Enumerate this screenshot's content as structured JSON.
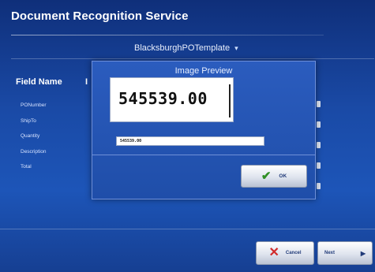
{
  "app": {
    "title": "Document Recognition Service"
  },
  "template": {
    "selected": "BlacksburghPOTemplate",
    "chevron_icon": "chevron-down-icon"
  },
  "fields": {
    "header": "Field Name",
    "header_partial": "I",
    "items": [
      "PONumber",
      "ShipTo",
      "Quantity",
      "Description",
      "Total"
    ]
  },
  "dialog": {
    "title": "Image Preview",
    "preview_value": "545539.00",
    "input_value": "545539.00",
    "ok_label": "OK",
    "ok_icon": "checkmark-icon"
  },
  "buttons": {
    "cancel_label": "Cancel",
    "cancel_icon": "x-icon",
    "next_label": "Next",
    "next_icon": "arrow-right-icon"
  },
  "colors": {
    "background": "#1a4aa6",
    "dialog": "#2b5cbe",
    "cancel_icon": "#d12b2b",
    "ok_icon": "#2f8f24"
  }
}
